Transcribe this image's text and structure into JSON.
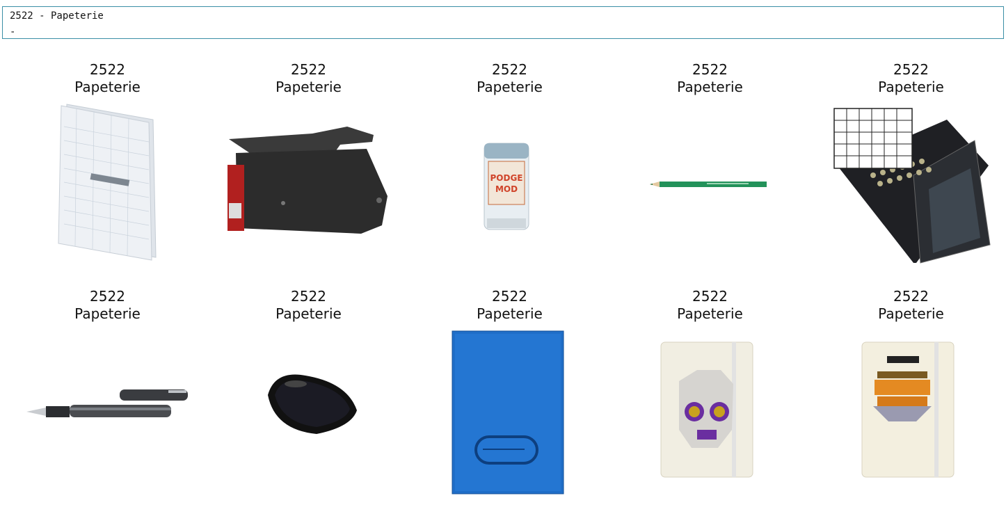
{
  "header": {
    "line1": "2522 - Papeterie",
    "line2": "-"
  },
  "products": [
    {
      "code": "2522",
      "category": "Papeterie",
      "icon": "grid-notebook-icon"
    },
    {
      "code": "2522",
      "category": "Papeterie",
      "icon": "date-stamp-icon"
    },
    {
      "code": "2522",
      "category": "Papeterie",
      "icon": "mod-podge-jar-icon"
    },
    {
      "code": "2522",
      "category": "Papeterie",
      "icon": "green-pencil-icon"
    },
    {
      "code": "2522",
      "category": "Papeterie",
      "icon": "pigment-palette-icon"
    },
    {
      "code": "2522",
      "category": "Papeterie",
      "icon": "fountain-pen-icon"
    },
    {
      "code": "2522",
      "category": "Papeterie",
      "icon": "ink-pad-icon"
    },
    {
      "code": "2522",
      "category": "Papeterie",
      "icon": "blue-folder-icon"
    },
    {
      "code": "2522",
      "category": "Papeterie",
      "icon": "skull-notebook-icon"
    },
    {
      "code": "2522",
      "category": "Papeterie",
      "icon": "house-notebook-icon"
    }
  ]
}
